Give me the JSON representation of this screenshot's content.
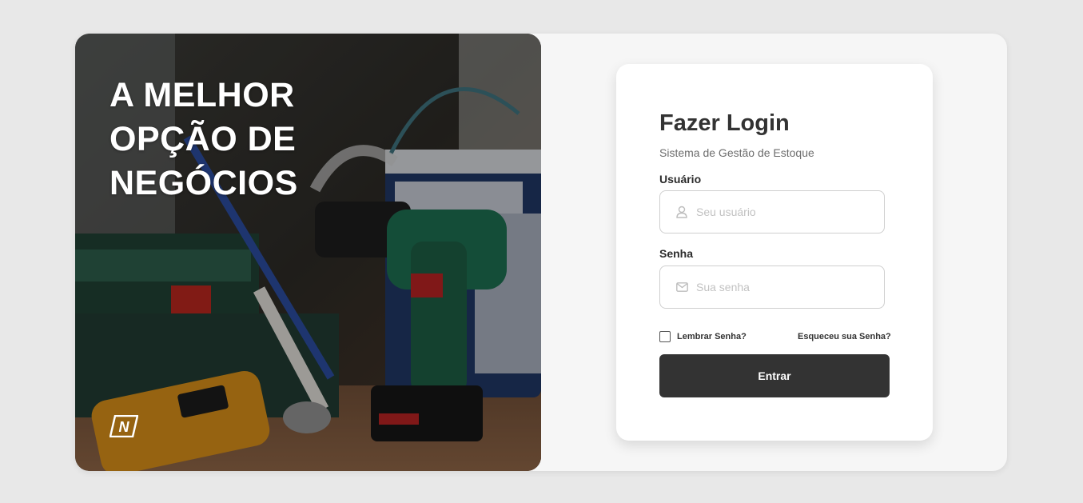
{
  "hero": {
    "title_lines": [
      "A MELHOR",
      "OPÇÃO DE",
      "NEGÓCIOS"
    ],
    "logo_letter": "N",
    "image": "power-drill-and-tools-photo"
  },
  "login": {
    "title": "Fazer Login",
    "subtitle": "Sistema de Gestão de Estoque",
    "username_label": "Usuário",
    "username_placeholder": "Seu usuário",
    "password_label": "Senha",
    "password_placeholder": "Sua senha",
    "remember_label": "Lembrar Senha?",
    "forgot_label": "Esqueceu sua Senha?",
    "submit_label": "Entrar"
  },
  "colors": {
    "page_background": "#e8e8e8",
    "card_background": "#f6f6f6",
    "button": "#333333",
    "title_text": "#333333"
  },
  "icons": {
    "username": "user-icon",
    "password": "envelope-icon",
    "logo": "n-logo-icon"
  }
}
